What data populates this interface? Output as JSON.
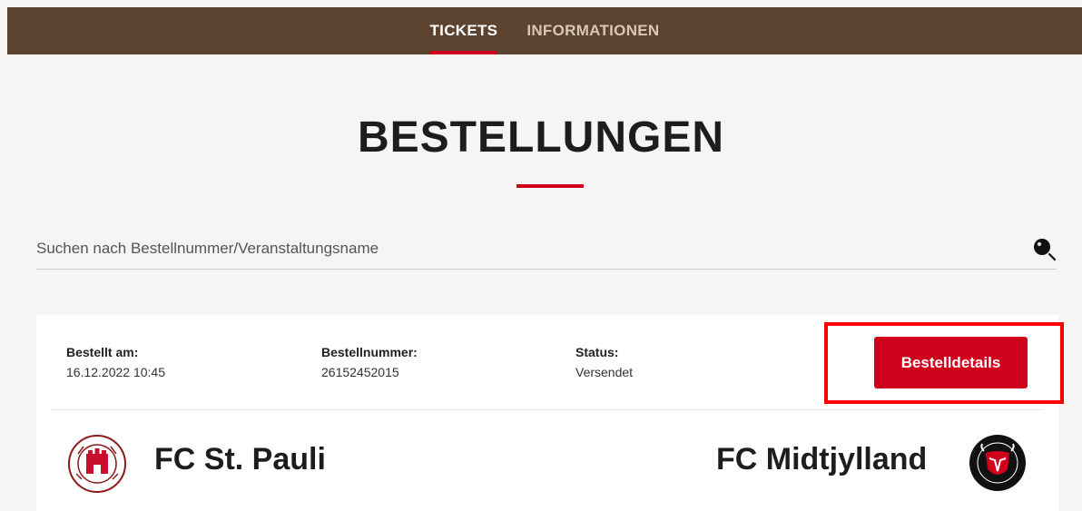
{
  "nav": {
    "tabs": [
      {
        "label": "TICKETS",
        "active": true
      },
      {
        "label": "INFORMATIONEN",
        "active": false
      }
    ]
  },
  "page": {
    "title": "BESTELLUNGEN"
  },
  "search": {
    "placeholder": "Suchen nach Bestellnummer/Veranstaltungsname",
    "icon": "search-icon"
  },
  "order": {
    "ordered_label": "Bestellt am:",
    "ordered_value": "16.12.2022 10:45",
    "number_label": "Bestellnummer:",
    "number_value": "26152452015",
    "status_label": "Status:",
    "status_value": "Versendet",
    "details_button": "Bestelldetails",
    "home_team": "FC St. Pauli",
    "home_logo": "fc-st-pauli-logo",
    "away_team": "FC Midtjylland",
    "away_logo": "fc-midtjylland-logo"
  },
  "colors": {
    "topbar": "#5c432f",
    "accent": "#d0021b",
    "highlight": "#ff0000"
  }
}
